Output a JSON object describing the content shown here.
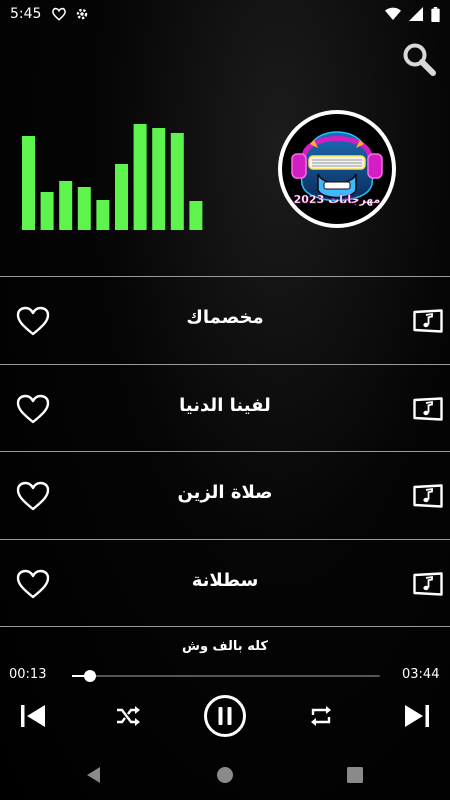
{
  "status_bar": {
    "time": "5:45",
    "left_icons": [
      "heart-outline-icon",
      "settings-gear-icon"
    ],
    "right_icons": [
      "wifi-icon",
      "signal-icon",
      "battery-icon"
    ]
  },
  "header": {
    "search_icon": "search-icon",
    "logo": {
      "text": "مهرجانات 2023",
      "description": "gorilla wearing headphones and shutter shades"
    },
    "visualizer": {
      "color": "#5ef34d",
      "levels": [
        0.78,
        0.32,
        0.41,
        0.36,
        0.25,
        0.55,
        0.88,
        0.85,
        0.81,
        0.24
      ]
    }
  },
  "songs": [
    {
      "title": "مخصماك",
      "favorite_icon": "heart-outline-icon",
      "music_icon": "music-folder-icon"
    },
    {
      "title": "لفينا الدنيا",
      "favorite_icon": "heart-outline-icon",
      "music_icon": "music-folder-icon"
    },
    {
      "title": "صلاة الزين",
      "favorite_icon": "heart-outline-icon",
      "music_icon": "music-folder-icon"
    },
    {
      "title": "سطلانة",
      "favorite_icon": "heart-outline-icon",
      "music_icon": "music-folder-icon"
    }
  ],
  "player": {
    "now_playing": "كله بالف وش",
    "current_time": "00:13",
    "total_time": "03:44",
    "progress": 0.06,
    "controls": [
      "skip-previous-icon",
      "shuffle-icon",
      "pause-icon",
      "repeat-icon",
      "skip-next-icon"
    ]
  },
  "nav_bar": [
    "back-icon",
    "home-icon",
    "recents-icon"
  ],
  "colors": {
    "background": "#000000",
    "text": "#ffffff",
    "divider": "#9a9a9a",
    "accent": "#5ef34d"
  }
}
